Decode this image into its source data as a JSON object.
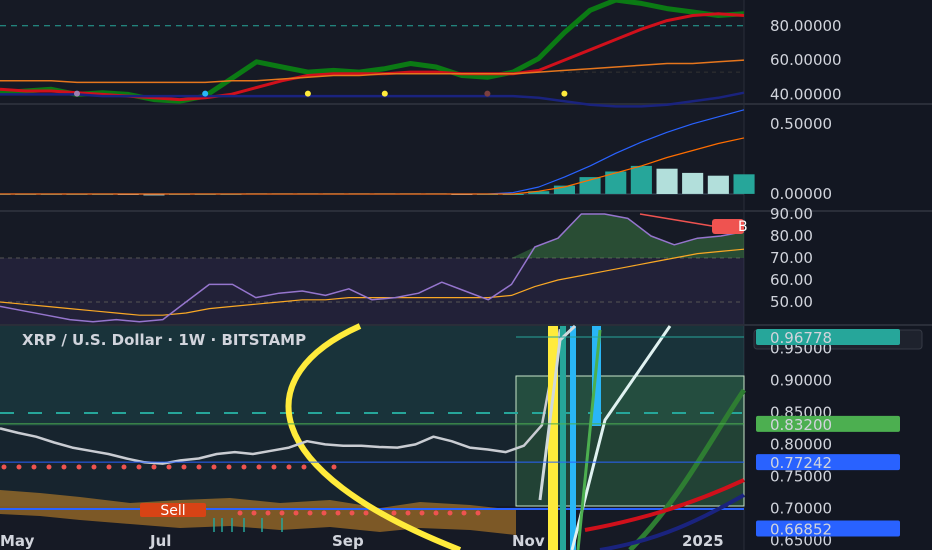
{
  "chart_data": [
    {
      "type": "line",
      "panel": "oscillator",
      "ylim": [
        35,
        95
      ],
      "ticks": [
        "80.00000",
        "60.00000",
        "40.00000"
      ],
      "tick_values": [
        80,
        60,
        40
      ],
      "reference_level": 80,
      "series": [
        {
          "color": "#0b7a14",
          "values": [
            41,
            42,
            43,
            40,
            41,
            40,
            37,
            36,
            39,
            49,
            59,
            56,
            53,
            54,
            53,
            55,
            58,
            56,
            51,
            50,
            53,
            61,
            76,
            89,
            95,
            93,
            90,
            88,
            86,
            87
          ]
        },
        {
          "color": "#d0101b",
          "values": [
            43,
            42,
            42,
            41,
            40,
            39,
            38,
            37,
            38,
            40,
            44,
            48,
            51,
            52,
            52,
            52,
            53,
            53,
            52,
            52,
            52,
            54,
            60,
            66,
            72,
            78,
            83,
            86,
            87,
            86
          ]
        },
        {
          "color": "#e6761d",
          "values": [
            48,
            48,
            48,
            47,
            47,
            47,
            47,
            47,
            47,
            48,
            48,
            49,
            50,
            51,
            51,
            52,
            52,
            52,
            52,
            52,
            52,
            53,
            54,
            55,
            56,
            57,
            58,
            58,
            59,
            60
          ]
        },
        {
          "color": "#1a237e",
          "values": [
            40,
            40,
            40,
            40,
            39,
            39,
            39,
            39,
            39,
            39,
            39,
            39,
            39,
            39,
            39,
            39,
            39,
            39,
            39,
            39,
            39,
            38,
            36,
            34,
            33,
            33,
            34,
            36,
            38,
            41
          ]
        }
      ],
      "markers": [
        {
          "x": 3,
          "color": "#9c7fb0"
        },
        {
          "x": 8,
          "color": "#29b6f6"
        },
        {
          "x": 12,
          "color": "#ffeb3b"
        },
        {
          "x": 15,
          "color": "#ffeb3b"
        },
        {
          "x": 19,
          "color": "#7b3f3f"
        },
        {
          "x": 22,
          "color": "#ffeb3b"
        }
      ]
    },
    {
      "type": "bar",
      "panel": "macd-histogram",
      "ylim": [
        -0.1,
        0.62
      ],
      "ticks": [
        "0.50000",
        "0.00000"
      ],
      "tick_values": [
        0.5,
        0
      ],
      "values": [
        0,
        0,
        0,
        0,
        0,
        -0.005,
        -0.01,
        -0.005,
        0,
        0,
        0.005,
        0.005,
        0.005,
        0.005,
        0.005,
        0.005,
        0.005,
        0.005,
        0,
        0,
        0,
        0.02,
        0.06,
        0.12,
        0.16,
        0.2,
        0.18,
        0.15,
        0.13,
        0.14
      ],
      "bar_colors": [
        "#26a69a",
        "#b2dfdb"
      ],
      "series": [
        {
          "color": "#2962ff",
          "values": [
            0,
            0,
            0,
            0,
            0,
            0,
            0,
            0,
            0,
            0,
            0,
            0,
            0,
            0,
            0,
            0,
            0,
            0,
            0,
            0,
            0.01,
            0.05,
            0.12,
            0.2,
            0.29,
            0.37,
            0.44,
            0.5,
            0.55,
            0.6
          ]
        },
        {
          "color": "#ff6d00",
          "values": [
            0,
            0,
            0,
            0,
            0,
            0,
            0,
            0,
            0,
            0,
            0,
            0,
            0,
            0,
            0,
            0,
            0,
            0,
            0,
            0,
            0,
            0.02,
            0.05,
            0.1,
            0.15,
            0.2,
            0.26,
            0.31,
            0.36,
            0.4
          ]
        }
      ]
    },
    {
      "type": "line",
      "panel": "rsi",
      "ylim": [
        40,
        90
      ],
      "ticks": [
        "90.00",
        "80.00",
        "70.00",
        "60.00",
        "50.00"
      ],
      "tick_values": [
        90,
        80,
        70,
        60,
        50
      ],
      "band": [
        70,
        30
      ],
      "series": [
        {
          "color": "#9575cd",
          "values": [
            48,
            46,
            44,
            42,
            41,
            42,
            41,
            42,
            50,
            58,
            58,
            52,
            54,
            55,
            53,
            56,
            51,
            52,
            54,
            59,
            55,
            51,
            58,
            75,
            79,
            90,
            90,
            88,
            80,
            76,
            79,
            80,
            82
          ]
        },
        {
          "color": "#f9a825",
          "values": [
            50,
            49,
            48,
            47,
            46,
            45,
            44,
            44,
            45,
            47,
            48,
            49,
            50,
            51,
            51,
            52,
            52,
            52,
            52,
            52,
            52,
            52,
            53,
            57,
            60,
            62,
            64,
            66,
            68,
            70,
            72,
            73,
            74
          ]
        }
      ],
      "badge": {
        "text": "B",
        "color": "#ef5350"
      }
    },
    {
      "type": "line",
      "panel": "price",
      "title": "XRP / U.S. Dollar · 1W · BITSTAMP",
      "currency": "USD",
      "ylim": [
        0.635,
        0.985
      ],
      "ticks": [
        "0.95000",
        "0.90000",
        "0.85000",
        "0.80000",
        "0.75000",
        "0.70000",
        "0.65000"
      ],
      "tick_values": [
        0.95,
        0.9,
        0.85,
        0.8,
        0.75,
        0.7,
        0.65
      ],
      "x_labels": [
        "May",
        "Jul",
        "Sep",
        "Nov",
        "2025"
      ],
      "series": [
        {
          "color": "#c9ccd2",
          "values": [
            0.825,
            0.818,
            0.812,
            0.803,
            0.795,
            0.79,
            0.785,
            0.778,
            0.772,
            0.77,
            0.775,
            0.778,
            0.785,
            0.788,
            0.785,
            0.79,
            0.795,
            0.805,
            0.8,
            0.798,
            0.798,
            0.796,
            0.795,
            0.8,
            0.812,
            0.805,
            0.795,
            0.792,
            0.788,
            0.798,
            0.83,
            0.98
          ]
        }
      ],
      "price_tags": [
        {
          "value": 0.96778,
          "label": "0.96778",
          "color": "#26a69a"
        },
        {
          "value": 0.832,
          "label": "0.83200",
          "color": "#4caf50"
        },
        {
          "value": 0.77242,
          "label": "0.77242",
          "color": "#2962ff"
        },
        {
          "value": 0.66852,
          "label": "0.66852",
          "color": "#2962ff"
        }
      ],
      "sell_tag": "Sell"
    }
  ]
}
